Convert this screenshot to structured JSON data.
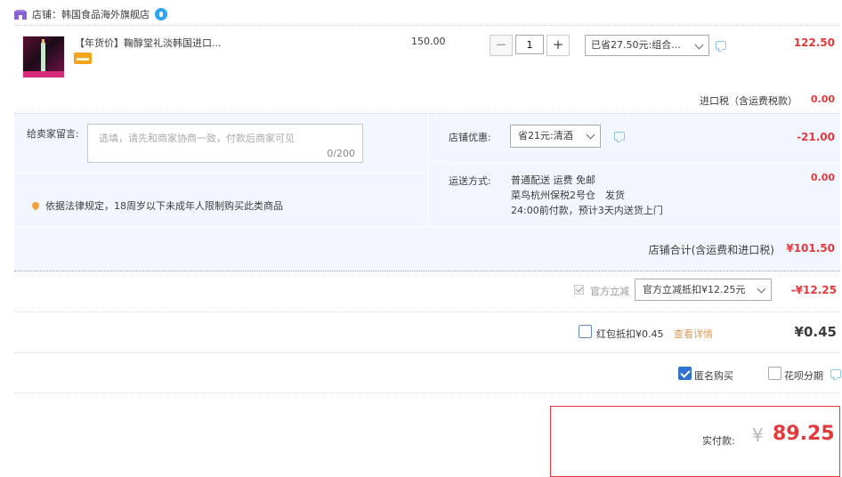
{
  "shop": {
    "label": "店铺：韩国食品海外旗舰店"
  },
  "item": {
    "title": "【年货价】鞠醇堂礼淡韩国进口...",
    "unit_price": "150.00",
    "quantity": "1",
    "qty_minus": "−",
    "qty_plus": "+",
    "promo_select": "已省27.50元:组合...",
    "subtotal": "122.50",
    "import_tax_label": "进口税（含运费税款）",
    "import_tax_value": "0.00"
  },
  "memo": {
    "label": "给卖家留言:",
    "placeholder": "选填，请先和商家协商一致，付款后商家可见",
    "count": "0/200"
  },
  "law_note": "依据法律规定，18周岁以下未成年人限制购买此类商品",
  "shop_promo": {
    "label": "店铺优惠:",
    "select": "省21元:清酒",
    "value": "-21.00"
  },
  "shipping": {
    "label": "运送方式:",
    "line1": "普通配送 运费 免邮",
    "line2": "菜鸟杭州保税2号仓　发货",
    "line3": "24:00前付款，预计3天内送货上门",
    "value": "0.00"
  },
  "shop_total": {
    "label": "店铺合计(含运费和进口税)",
    "value": "¥101.50"
  },
  "official_discount": {
    "label": "官方立减",
    "select": "官方立减抵扣¥12.25元",
    "value": "-¥12.25"
  },
  "red_packet": {
    "label": "红包抵扣¥0.45",
    "detail_link": "查看详情",
    "value": "¥0.45"
  },
  "options": {
    "anonymous_label": "匿名购买",
    "anonymous_checked": true,
    "huabei_label": "花呗分期"
  },
  "total": {
    "label": "实付款:",
    "currency": "¥",
    "value": "89.25"
  },
  "colors": {
    "accent_red": "#e4393c",
    "checkbox_blue": "#2f72d1",
    "panel_blue": "#f2f7ff"
  }
}
